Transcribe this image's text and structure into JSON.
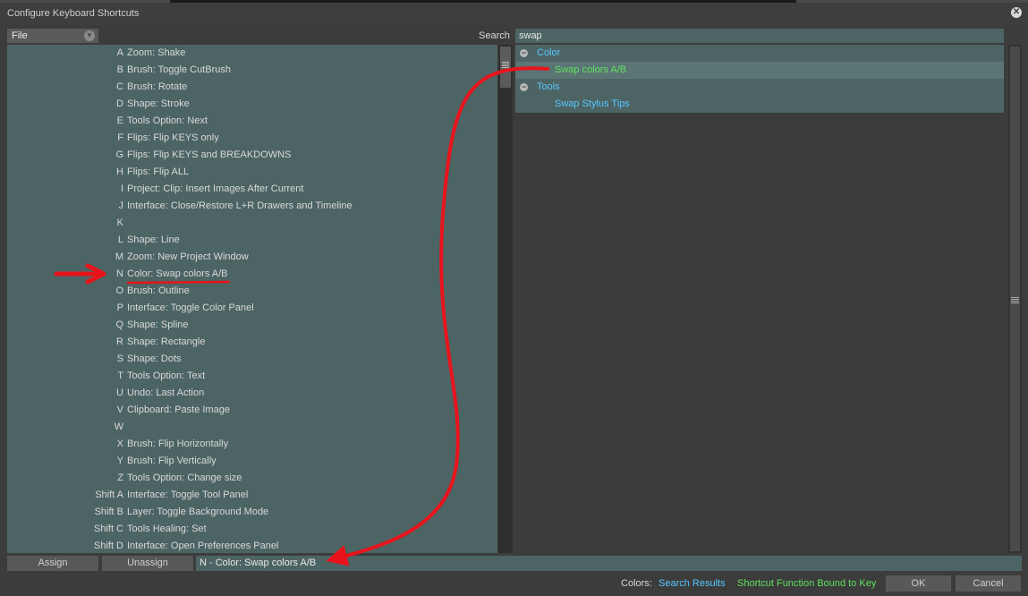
{
  "window": {
    "title": "Configure Keyboard Shortcuts",
    "close_icon": "close-icon"
  },
  "filter": {
    "selected": "File"
  },
  "search": {
    "label": "Search",
    "value": "swap"
  },
  "shortcuts": [
    {
      "key": "A",
      "function": "Zoom: Shake"
    },
    {
      "key": "B",
      "function": "Brush: Toggle CutBrush"
    },
    {
      "key": "C",
      "function": "Brush: Rotate"
    },
    {
      "key": "D",
      "function": "Shape: Stroke"
    },
    {
      "key": "E",
      "function": "Tools Option: Next"
    },
    {
      "key": "F",
      "function": "Flips: Flip KEYS only"
    },
    {
      "key": "G",
      "function": "Flips: Flip KEYS and BREAKDOWNS"
    },
    {
      "key": "H",
      "function": "Flips: Flip ALL"
    },
    {
      "key": "I",
      "function": "Project: Clip: Insert Images After Current"
    },
    {
      "key": "J",
      "function": "Interface: Close/Restore L+R Drawers and Timeline"
    },
    {
      "key": "K",
      "function": ""
    },
    {
      "key": "L",
      "function": "Shape: Line"
    },
    {
      "key": "M",
      "function": "Zoom: New Project Window"
    },
    {
      "key": "N",
      "function": "Color: Swap colors A/B"
    },
    {
      "key": "O",
      "function": "Brush: Outline"
    },
    {
      "key": "P",
      "function": "Interface: Toggle Color Panel"
    },
    {
      "key": "Q",
      "function": "Shape: Spline"
    },
    {
      "key": "R",
      "function": "Shape: Rectangle"
    },
    {
      "key": "S",
      "function": "Shape: Dots"
    },
    {
      "key": "T",
      "function": "Tools Option: Text"
    },
    {
      "key": "U",
      "function": "Undo: Last Action"
    },
    {
      "key": "V",
      "function": "Clipboard: Paste Image"
    },
    {
      "key": "W",
      "function": ""
    },
    {
      "key": "X",
      "function": "Brush: Flip Horizontally"
    },
    {
      "key": "Y",
      "function": "Brush: Flip Vertically"
    },
    {
      "key": "Z",
      "function": "Tools Option: Change size"
    },
    {
      "key": "Shift A",
      "function": "Interface: Toggle Tool Panel"
    },
    {
      "key": "Shift B",
      "function": "Layer: Toggle Background Mode"
    },
    {
      "key": "Shift C",
      "function": "Tools Healing: Set"
    },
    {
      "key": "Shift D",
      "function": "Interface: Open Preferences Panel"
    }
  ],
  "results": [
    {
      "kind": "category",
      "label": "Color",
      "toggle": "⊖"
    },
    {
      "kind": "item",
      "label": "Swap colors A/B",
      "bound": true,
      "selected": true
    },
    {
      "kind": "category",
      "label": "Tools",
      "toggle": "⊖"
    },
    {
      "kind": "item",
      "label": "Swap Stylus Tips",
      "bound": false,
      "selected": false
    }
  ],
  "buttons": {
    "assign": "Assign",
    "unassign": "Unassign",
    "ok": "OK",
    "cancel": "Cancel"
  },
  "binding": {
    "text": "N - Color: Swap colors A/B"
  },
  "legend": {
    "label": "Colors:",
    "search_results": "Search Results",
    "bound": "Shortcut Function Bound to Key"
  },
  "colors": {
    "search_result": "#56c8ff",
    "bound": "#5fe15f",
    "panel": "#4d6464",
    "annotation": "#e8141c"
  }
}
